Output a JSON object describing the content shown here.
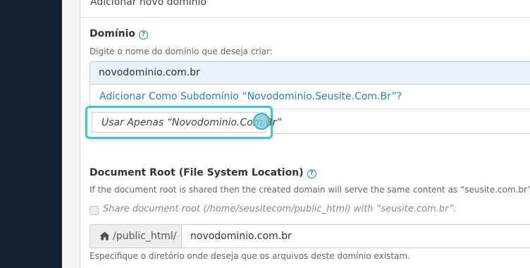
{
  "panel": {
    "heading": "Adicionar novo domínio"
  },
  "domain": {
    "label": "Domínio",
    "help_icon": "question-circle-icon",
    "hint": "Digite o nome do domínio que deseja criar:",
    "value": "novodominio.com.br",
    "suggestions": {
      "subdomain": "Adicionar Como Subdomínio “Novodominio.Seusite.Com.Br”?",
      "only": "Usar Apenas “Novodominio.Com.Br”"
    }
  },
  "docroot": {
    "label": "Document Root (File System Location)",
    "help_icon": "question-circle-icon",
    "hint": "If the document root is shared then the created domain will serve the same content as “seusite.com.br”",
    "share_label": "Share document root (/home/seusitecom/public_html) with “seusite.com.br”.",
    "share_checked": false,
    "prefix_icon": "home-icon",
    "prefix": "/public_html/",
    "value": "novodominio.com.br",
    "footer_hint": "Especifique o diretório onde deseja que os arquivos deste domínio existam."
  },
  "colors": {
    "sidebar": "#162230",
    "link": "#2f7fbd",
    "focus": "#45c4c9",
    "input_active": "#eaf2fb"
  }
}
